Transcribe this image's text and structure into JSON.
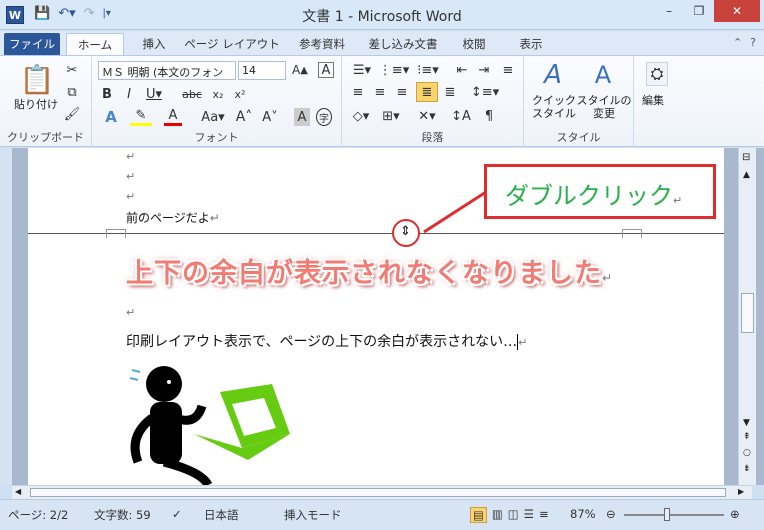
{
  "window": {
    "title": "文書 1 - Microsoft Word",
    "help_icon": "?",
    "minimize": "–",
    "restore": "❐",
    "close": "✕"
  },
  "qat": {
    "app_icon": "W",
    "save_icon": "save-icon",
    "undo_icon": "undo-icon",
    "redo_icon": "redo-icon"
  },
  "tabs": [
    "ファイル",
    "ホーム",
    "挿入",
    "ページ レイアウト",
    "参考資料",
    "差し込み文書",
    "校閲",
    "表示"
  ],
  "ribbon": {
    "clipboard": {
      "paste_label": "貼り付け",
      "group_label": "クリップボード"
    },
    "font": {
      "name": "ＭＳ 明朝 (本文のフォン",
      "size": "14",
      "group_label": "フォント"
    },
    "paragraph": {
      "group_label": "段落"
    },
    "styles": {
      "quick_label": "クイック\nスタイル",
      "change_label": "スタイルの\n変更",
      "group_label": "スタイル"
    },
    "editing": {
      "label": "編集"
    }
  },
  "document": {
    "line_prev_page": "前のページだよ",
    "para_mark": "↵",
    "heading": "上下の余白が表示されなくなりました",
    "body_line": "印刷レイアウト表示で、ページの上下の余白が表示されない…",
    "callout": "ダブルクリック"
  },
  "status": {
    "page": "ページ: 2/2",
    "words": "文字数: 59",
    "language": "日本語",
    "mode": "挿入モード",
    "zoom": "87%"
  },
  "colors": {
    "accent": "#2b579a",
    "callout_border": "#e02c2c",
    "callout_text": "#28b04a",
    "heading": "#f27b73",
    "close_button": "#c7423a"
  }
}
